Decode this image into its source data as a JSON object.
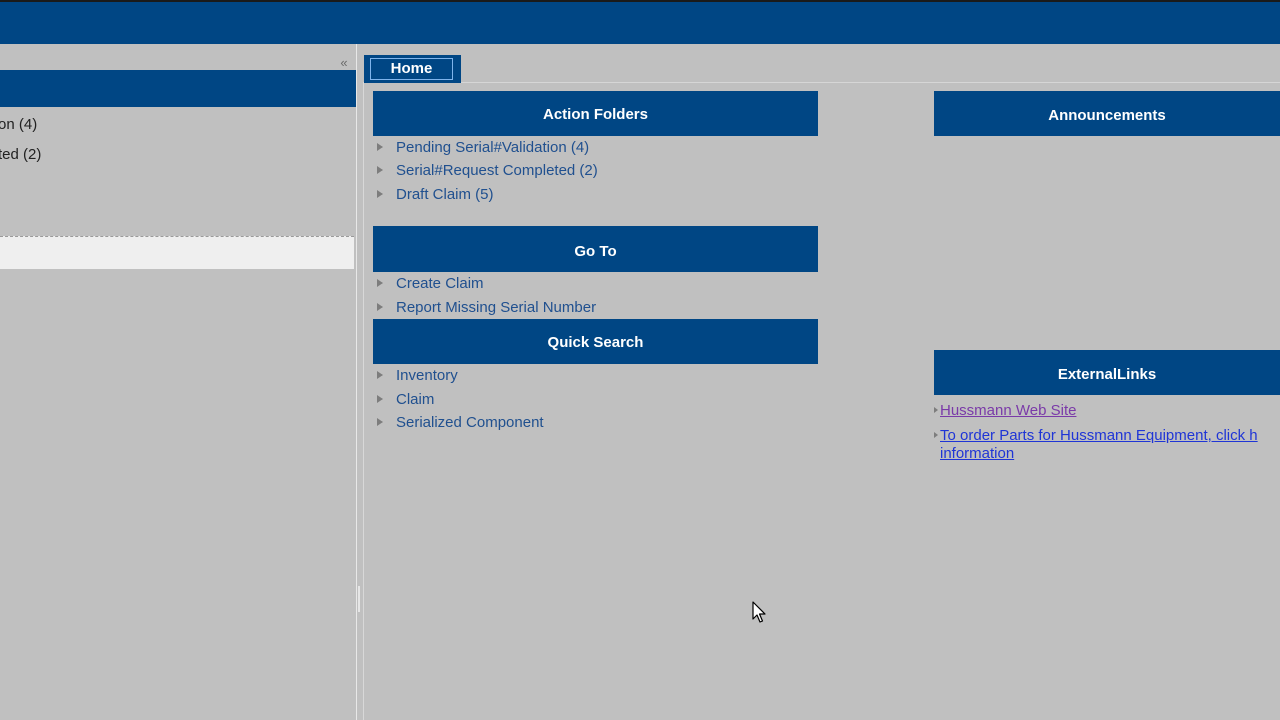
{
  "sidebar": {
    "collapse_glyph": "«",
    "items": [
      {
        "label": "on (4)"
      },
      {
        "label": "ted (2)"
      }
    ]
  },
  "tabs": [
    {
      "label": "Home",
      "active": true
    }
  ],
  "action_folders": {
    "title": "Action Folders",
    "items": [
      {
        "label": "Pending Serial#Validation (4)"
      },
      {
        "label": "Serial#Request Completed (2)"
      },
      {
        "label": "Draft Claim (5)"
      }
    ]
  },
  "go_to": {
    "title": "Go To",
    "items": [
      {
        "label": "Create Claim"
      },
      {
        "label": "Report Missing Serial Number"
      }
    ]
  },
  "quick_search": {
    "title": "Quick Search",
    "items": [
      {
        "label": "Inventory"
      },
      {
        "label": "Claim"
      },
      {
        "label": "Serialized Component"
      }
    ]
  },
  "announcements": {
    "title": "Announcements"
  },
  "external_links": {
    "title": "ExternalLinks",
    "items": [
      {
        "label": "Hussmann Web Site"
      },
      {
        "label_line1": "To order Parts for Hussmann Equipment, click h",
        "label_line2": "information"
      }
    ]
  },
  "colors": {
    "header_blue": "#004684",
    "background": "#c0c0c0",
    "link": "#20508f",
    "visited_link": "#7a3aa8",
    "external_link": "#1f35d6"
  },
  "icons": {
    "collapse": "double-chevron-left-icon",
    "bullet": "triangle-right-icon",
    "pointer": "mouse-cursor-icon"
  }
}
